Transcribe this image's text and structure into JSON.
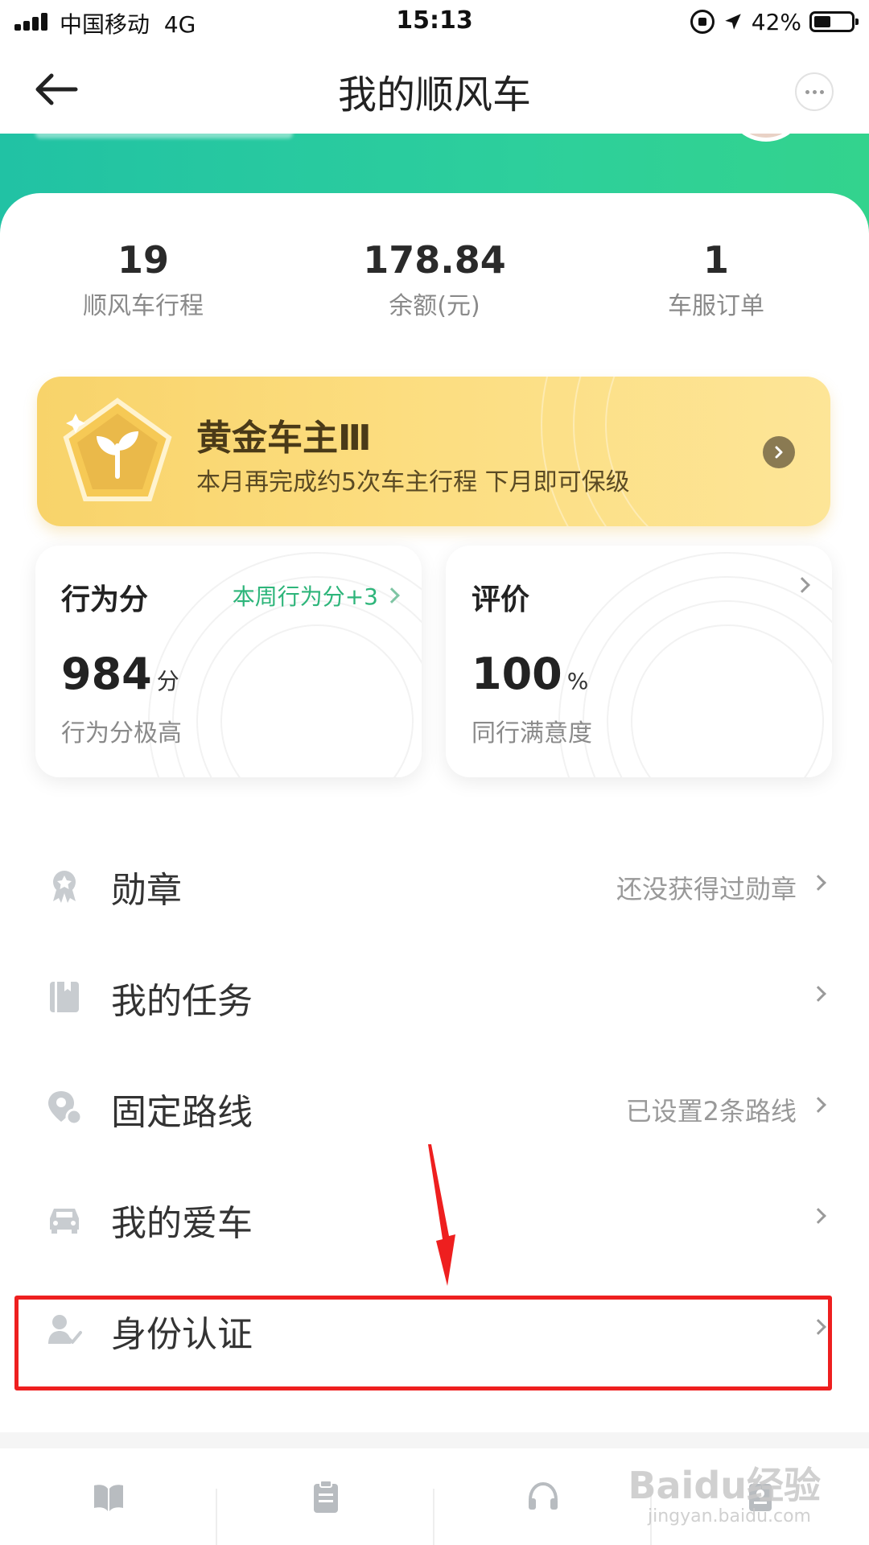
{
  "status_bar": {
    "carrier": "中国移动",
    "network": "4G",
    "time": "15:13",
    "battery": "42%"
  },
  "nav": {
    "title": "我的顺风车"
  },
  "stats": [
    {
      "value": "19",
      "label": "顺风车行程"
    },
    {
      "value": "178.84",
      "label": "余额(元)"
    },
    {
      "value": "1",
      "label": "车服订单"
    }
  ],
  "gold_card": {
    "title": "黄金车主Ⅲ",
    "subtitle": "本月再完成约5次车主行程 下月即可保级"
  },
  "behavior_card": {
    "title": "行为分",
    "link": "本周行为分+3",
    "value": "984",
    "unit": "分",
    "desc": "行为分极高"
  },
  "rating_card": {
    "title": "评价",
    "value": "100",
    "unit": "%",
    "desc": "同行满意度"
  },
  "menu": [
    {
      "label": "勋章",
      "value": "还没获得过勋章",
      "icon": "medal-icon"
    },
    {
      "label": "我的任务",
      "value": "",
      "icon": "task-book-icon"
    },
    {
      "label": "固定路线",
      "value": "已设置2条路线",
      "icon": "route-pin-icon"
    },
    {
      "label": "我的爱车",
      "value": "",
      "icon": "car-icon"
    },
    {
      "label": "身份认证",
      "value": "",
      "icon": "identity-check-icon"
    }
  ],
  "tabbar": {
    "icons": [
      "book-icon",
      "clipboard-icon",
      "headset-icon",
      "profile-icon"
    ]
  },
  "watermark": {
    "brand": "Baidu经验",
    "domain": "jingyan.baidu.com"
  },
  "colors": {
    "accent_green": "#2db57a",
    "header_green": "#21c2a4",
    "gold": "#fcdd7f",
    "annotation_red": "#ee1f1f"
  }
}
